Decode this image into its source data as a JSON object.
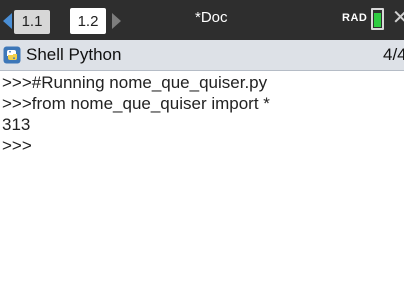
{
  "tabs": [
    {
      "label": "1.1",
      "active": false
    },
    {
      "label": "1.2",
      "active": true
    }
  ],
  "document_title": "*Doc",
  "mode": "RAD",
  "battery_level": 0.8,
  "app": {
    "title": "Shell Python",
    "page_indicator": "4/4"
  },
  "shell_lines": [
    ">>>#Running nome_que_quiser.py",
    ">>>from nome_que_quiser import *",
    "313",
    ">>>"
  ],
  "colors": {
    "tabbar_bg": "#2e2e2e",
    "header_bg": "#dde1e7",
    "battery": "#2ecc40",
    "nav_active": "#4a8fd6"
  },
  "icons": [
    "chevron-left-icon",
    "chevron-right-icon",
    "battery-icon",
    "close-icon",
    "python-icon"
  ]
}
